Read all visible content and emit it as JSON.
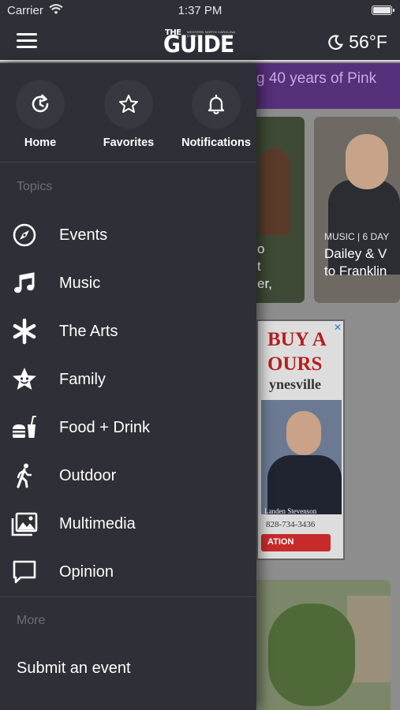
{
  "status_bar": {
    "carrier": "Carrier",
    "time": "1:37 PM"
  },
  "header": {
    "logo_small": "THE",
    "logo_sub": "WESTERN NORTH CAROLINA EVENTS",
    "logo_main": "GUIDE",
    "weather": "56°F"
  },
  "drawer": {
    "quick_links": [
      {
        "label": "Home",
        "icon": "refresh-clock-icon"
      },
      {
        "label": "Favorites",
        "icon": "star-icon"
      },
      {
        "label": "Notifications",
        "icon": "bell-icon"
      }
    ],
    "topics_heading": "Topics",
    "topics": [
      {
        "label": "Events",
        "icon": "compass-icon"
      },
      {
        "label": "Music",
        "icon": "music-note-icon"
      },
      {
        "label": "The Arts",
        "icon": "asterisk-icon"
      },
      {
        "label": "Family",
        "icon": "star-face-icon"
      },
      {
        "label": "Food + Drink",
        "icon": "burger-drink-icon"
      },
      {
        "label": "Outdoor",
        "icon": "walking-person-icon"
      },
      {
        "label": "Multimedia",
        "icon": "photo-gallery-icon"
      },
      {
        "label": "Opinion",
        "icon": "speech-bubble-icon"
      }
    ],
    "more_heading": "More",
    "submit_label": "Submit an event"
  },
  "background": {
    "banner_text": "g 40 years of Pink",
    "card1_partial": "o\nt\ner,",
    "card2_meta": "MUSIC | 6 DAY",
    "card2_headline": "Dailey & V\nto Franklin",
    "ad_headline": "BUY A\nOURS",
    "ad_town": "ynesville",
    "ad_name": "Landen Stevenson",
    "ad_phone": "828-734-3436",
    "ad_cta": "ATION"
  },
  "colors": {
    "drawer_bg": "#2f2f37",
    "banner_bg": "#56307a",
    "ad_red": "#b52020"
  }
}
